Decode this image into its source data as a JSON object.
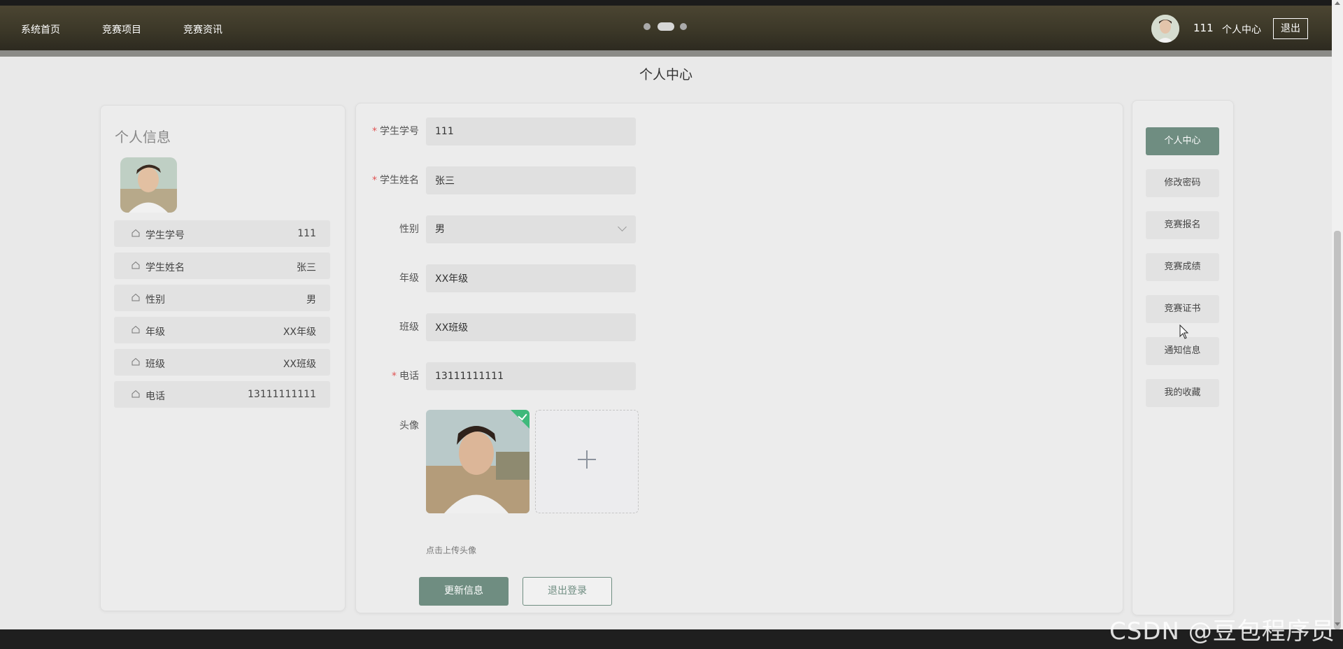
{
  "nav": {
    "items": [
      "系统首页",
      "竞赛项目",
      "竞赛资讯"
    ],
    "user_name": "111",
    "user_center": "个人中心",
    "logout": "退出"
  },
  "page_title": "个人中心",
  "profile": {
    "title": "个人信息",
    "rows": [
      {
        "label": "学生学号",
        "value": "111"
      },
      {
        "label": "学生姓名",
        "value": "张三"
      },
      {
        "label": "性别",
        "value": "男"
      },
      {
        "label": "年级",
        "value": "XX年级"
      },
      {
        "label": "班级",
        "value": "XX班级"
      },
      {
        "label": "电话",
        "value": "13111111111"
      }
    ]
  },
  "form": {
    "student_id": {
      "label": "学生学号",
      "value": "111",
      "required": true
    },
    "student_name": {
      "label": "学生姓名",
      "value": "张三",
      "required": true
    },
    "gender": {
      "label": "性别",
      "value": "男",
      "required": false
    },
    "grade": {
      "label": "年级",
      "value": "XX年级",
      "required": false
    },
    "class": {
      "label": "班级",
      "value": "XX班级",
      "required": false
    },
    "phone": {
      "label": "电话",
      "value": "13111111111",
      "required": true
    },
    "avatar": {
      "label": "头像",
      "tip": "点击上传头像"
    },
    "submit": "更新信息",
    "logout": "退出登录"
  },
  "side_menu": [
    "个人中心",
    "修改密码",
    "竞赛报名",
    "竞赛成绩",
    "竞赛证书",
    "通知信息",
    "我的收藏"
  ],
  "watermark": "CSDN @豆包程序员",
  "colors": {
    "accent": "#6f8d81",
    "success_badge": "#3fb97b",
    "required": "#e05555"
  }
}
